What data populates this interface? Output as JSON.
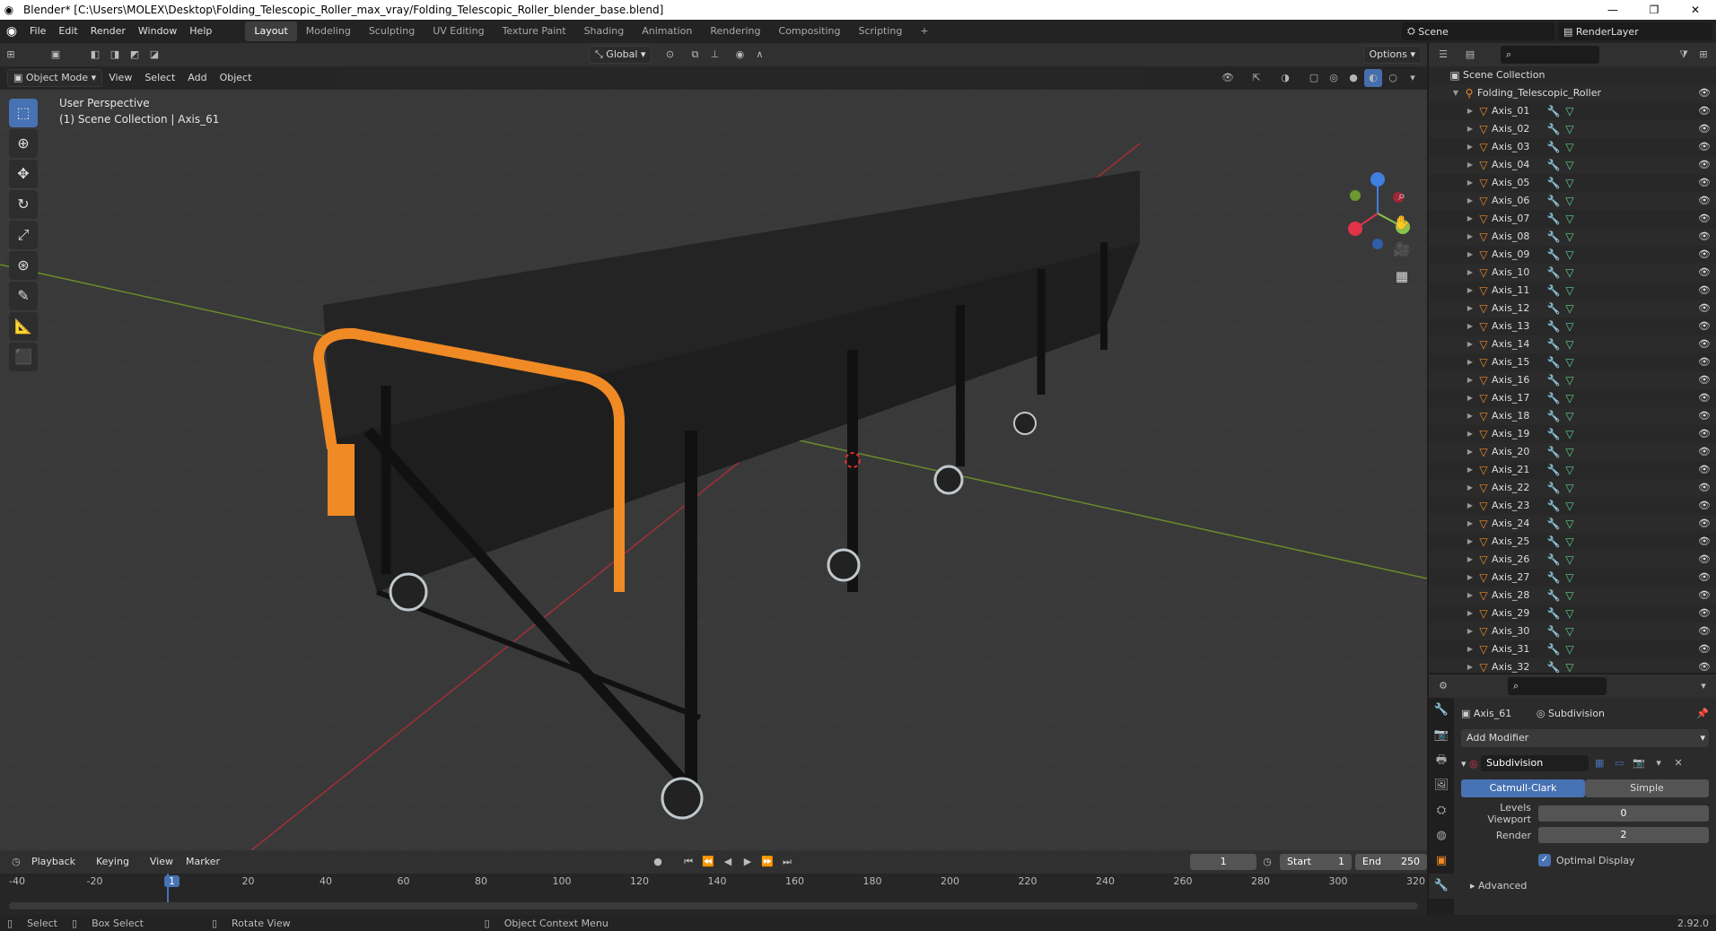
{
  "window": {
    "title": "Blender* [C:\\Users\\MOLEX\\Desktop\\Folding_Telescopic_Roller_max_vray/Folding_Telescopic_Roller_blender_base.blend]"
  },
  "menu": [
    "File",
    "Edit",
    "Render",
    "Window",
    "Help"
  ],
  "workspaces": [
    "Layout",
    "Modeling",
    "Sculpting",
    "UV Editing",
    "Texture Paint",
    "Shading",
    "Animation",
    "Rendering",
    "Compositing",
    "Scripting"
  ],
  "top_right": {
    "scene": "Scene",
    "render_layer": "RenderLayer"
  },
  "viewport_header": {
    "transform_orientation": "Global",
    "options": "Options",
    "mode": "Object Mode",
    "menus": [
      "View",
      "Select",
      "Add",
      "Object"
    ]
  },
  "viewport_overlay": {
    "line1": "User Perspective",
    "line2": "(1) Scene Collection | Axis_61"
  },
  "outliner": {
    "scene_collection": "Scene Collection",
    "root": "Folding_Telescopic_Roller",
    "items": [
      "Axis_01",
      "Axis_02",
      "Axis_03",
      "Axis_04",
      "Axis_05",
      "Axis_06",
      "Axis_07",
      "Axis_08",
      "Axis_09",
      "Axis_10",
      "Axis_11",
      "Axis_12",
      "Axis_13",
      "Axis_14",
      "Axis_15",
      "Axis_16",
      "Axis_17",
      "Axis_18",
      "Axis_19",
      "Axis_20",
      "Axis_21",
      "Axis_22",
      "Axis_23",
      "Axis_24",
      "Axis_25",
      "Axis_26",
      "Axis_27",
      "Axis_28",
      "Axis_29",
      "Axis_30",
      "Axis_31",
      "Axis_32"
    ]
  },
  "properties": {
    "object": "Axis_61",
    "modifier_tab": "Subdivision",
    "add_modifier": "Add Modifier",
    "modifier_name": "Subdivision",
    "catmull": "Catmull-Clark",
    "simple": "Simple",
    "levels_label": "Levels Viewport",
    "levels_value": "0",
    "render_label": "Render",
    "render_value": "2",
    "optimal": "Optimal Display",
    "advanced": "Advanced"
  },
  "timeline": {
    "menus": [
      "Playback",
      "Keying",
      "View",
      "Marker"
    ],
    "current": "1",
    "start_label": "Start",
    "start": "1",
    "end_label": "End",
    "end": "250",
    "ticks": [
      "-40",
      "-20",
      "1",
      "20",
      "40",
      "60",
      "80",
      "100",
      "120",
      "140",
      "160",
      "180",
      "200",
      "220",
      "240",
      "260",
      "280",
      "300",
      "320"
    ]
  },
  "status": {
    "select": "Select",
    "box_select": "Box Select",
    "rotate": "Rotate View",
    "context": "Object Context Menu",
    "version": "2.92.0"
  },
  "colors": {
    "accent": "#4772b3",
    "orange": "#f08a24",
    "axis_x": "#e0334a",
    "axis_y": "#8bc34a",
    "axis_z": "#3f7fe0"
  }
}
